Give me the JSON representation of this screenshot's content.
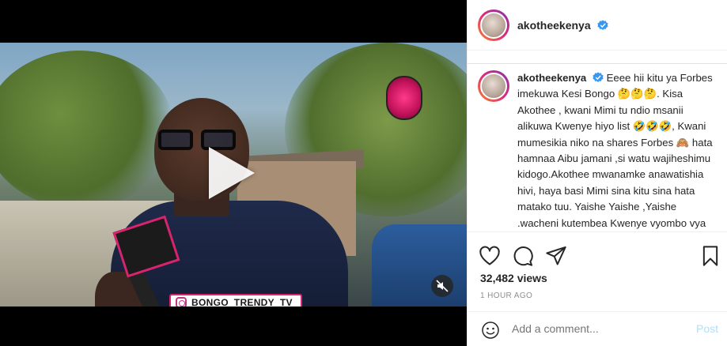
{
  "post": {
    "username": "akotheekenya",
    "verified": true
  },
  "media": {
    "watermark_text": "BONGO_TRENDY_TV",
    "play_icon": "play-icon",
    "mute_icon": "speaker-muted-icon"
  },
  "caption": {
    "username": "akotheekenya",
    "text": "Eeee hii kitu ya Forbes imekuwa Kesi Bongo 🤔🤔🤔. Kisa Akothee , kwani Mimi tu ndio msanii alikuwa Kwenye hiyo list 🤣🤣🤣, Kwani mumesikia niko na shares Forbes 🙈 hata hamnaa Aibu jamani ,si watu wajiheshimu kidogo.Akothee mwanamke anawatishia hivi, haya basi Mimi sina kitu sina hata matako tuu. Yaishe Yaishe ,Yaishe .wacheni kutembea Kwenye vyombo vya jabari"
  },
  "actions": {
    "like_icon": "heart-icon",
    "comment_icon": "comment-icon",
    "share_icon": "share-icon",
    "save_icon": "bookmark-icon"
  },
  "stats": {
    "views": "32,482 views",
    "time": "1 HOUR AGO"
  },
  "comment_box": {
    "placeholder": "Add a comment...",
    "post_label": "Post",
    "emoji_icon": "emoji-icon"
  },
  "colors": {
    "verified_blue": "#3897f0",
    "post_button": "#b2dffc",
    "secondary_text": "#8e8e8e"
  }
}
